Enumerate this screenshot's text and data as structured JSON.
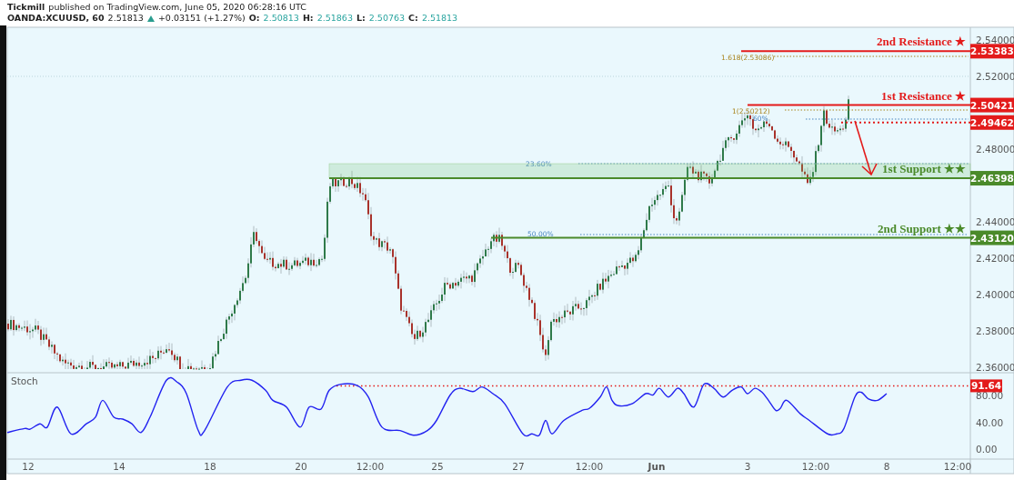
{
  "header": {
    "publisher": "Tickmill",
    "published": "published on TradingView.com, June 05, 2020 06:28:16 UTC",
    "symbol": "OANDA:XCUUSD, 60",
    "last": "2.51813",
    "change": "+0.03151 (+1.27%)",
    "ohlc": [
      {
        "label": "O:",
        "value": "2.50813"
      },
      {
        "label": "H:",
        "value": "2.51863"
      },
      {
        "label": "L:",
        "value": "2.50763"
      },
      {
        "label": "C:",
        "value": "2.51813"
      }
    ]
  },
  "price_axis": [
    "2.54000",
    "2.52000",
    "2.48000",
    "2.44000",
    "2.42000",
    "2.40000",
    "2.38000",
    "2.36000"
  ],
  "levels": [
    {
      "kind": "resistance",
      "label": "2nd Resistance ★",
      "price": "2.53383"
    },
    {
      "kind": "resistance",
      "label": "1st Resistance ★",
      "price": "2.50421"
    },
    {
      "kind": "pivot",
      "price": "2.49462"
    },
    {
      "kind": "support",
      "label": "1st Support ★★",
      "price": "2.46398"
    },
    {
      "kind": "support",
      "label": "2nd Support ★★",
      "price": "2.43120"
    }
  ],
  "fib_labels": [
    {
      "kind": "extension",
      "label": "1.618(2.53086)"
    },
    {
      "kind": "extension",
      "label": "1(2.50212)"
    },
    {
      "kind": "retracement",
      "label": "60%"
    },
    {
      "kind": "retracement",
      "label": "23.60%"
    },
    {
      "kind": "retracement",
      "label": "50.00%"
    }
  ],
  "stoch": {
    "title": "Stoch",
    "axis": [
      "80.00",
      "40.00",
      "0.00"
    ],
    "marker": "91.64"
  },
  "time_axis": [
    {
      "label": "12"
    },
    {
      "label": "14"
    },
    {
      "label": "18"
    },
    {
      "label": "20"
    },
    {
      "label": "12:00"
    },
    {
      "label": "25"
    },
    {
      "label": "27"
    },
    {
      "label": "12:00"
    },
    {
      "label": "Jun",
      "kind": "month"
    },
    {
      "label": "3"
    },
    {
      "label": "12:00"
    },
    {
      "label": "8"
    },
    {
      "label": "12:00"
    }
  ]
}
